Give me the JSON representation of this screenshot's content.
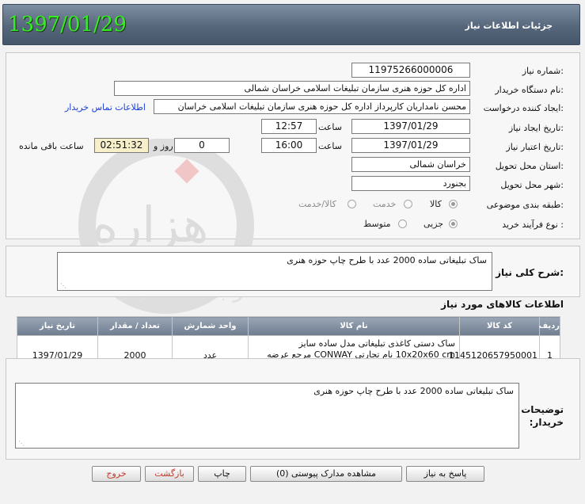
{
  "header": {
    "title": "جزئیات اطلاعات نیاز",
    "date": "1397/01/29"
  },
  "form": {
    "need_number_label": "شماره نیاز:",
    "need_number": "11975266000006",
    "buyer_org_label": "نام دستگاه خریدار:",
    "buyer_org": "اداره کل حوزه هنری سازمان تبلیغات اسلامی خراسان شمالی",
    "requester_label": "ایجاد کننده درخواست:",
    "requester": "محسن  نامداریان کارپرداز اداره کل حوزه هنری سازمان تبلیغات اسلامی خراسان",
    "contact_link": "اطلاعات تماس خریدار",
    "created_label": "تاریخ ایجاد نیاز:",
    "created_date": "1397/01/29",
    "time_label": "ساعت",
    "created_time": "12:57",
    "validity_label": "تاریخ اعتبار نیاز:",
    "validity_date": "1397/01/29",
    "validity_time": "16:00",
    "days_value": "0",
    "days_label": "روز و",
    "remaining_time": "02:51:32",
    "remaining_label": "ساعت باقی مانده",
    "province_label": "استان محل تحویل:",
    "province": "خراسان شمالی",
    "city_label": "شهر محل تحویل:",
    "city": "بجنورد",
    "category_label": "طبقه بندی موضوعی:",
    "category_options": [
      "کالا",
      "خدمت",
      "کالا/خدمت"
    ],
    "process_label": "نوع فرآیند خرید :",
    "process_options": [
      "جزیی",
      "متوسط"
    ]
  },
  "general_desc": {
    "label": "شرح کلی نیاز:",
    "text": "ساک تبلیغاتی ساده 2000 عدد با طرح چاپ حوزه هنری"
  },
  "items_section": {
    "title": "اطلاعات کالاهای مورد نیاز",
    "columns": [
      "ردیف",
      "کد کالا",
      "نام کالا",
      "واحد شمارش",
      "تعداد / مقدار",
      "تاریخ نیاز"
    ],
    "rows": [
      {
        "row": "1",
        "code": "1145120657950001",
        "name": "ساک دستی کاغذی تبلیغاتی مدل ساده سایز 10x20x60 cm نام تجارتی CONWAY مرجع عرضه کننده گلدانه عینک پارت مرجع سازنده CONWAY چین",
        "unit": "عدد",
        "qty": "2000",
        "date": "1397/01/29"
      }
    ]
  },
  "buyer_notes": {
    "label": "توضیحات خریدار:",
    "text": "ساک تبلیغاتی ساده 2000 عدد با طرح چاپ حوزه هنری"
  },
  "buttons": {
    "reply": "پاسخ به نیاز",
    "attachments": "مشاهده مدارک پیوستی (0)",
    "print": "چاپ",
    "back": "بازگشت",
    "exit": "خروج"
  },
  "watermark": {
    "text1": "هزاره",
    "text2": "ارتباط گستران"
  },
  "colors": {
    "header_date": "#33ee22",
    "header_bg": "#56667b",
    "link": "#1a3fd6",
    "remaining_bg": "#f6efc9"
  }
}
